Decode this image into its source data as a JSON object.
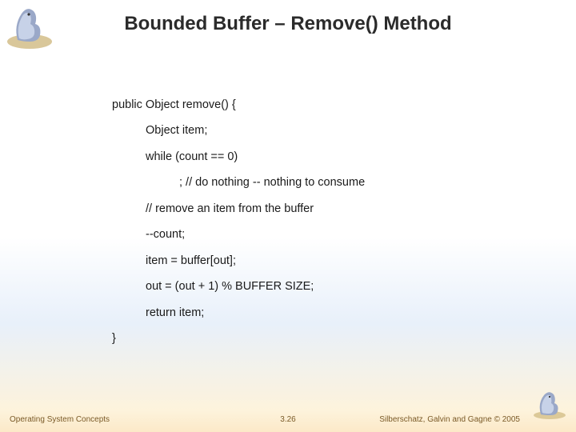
{
  "title": "Bounded Buffer – Remove() Method",
  "code": {
    "line1": "public Object remove() {",
    "line2": "Object item;",
    "line3": "while (count == 0)",
    "line4": "; // do nothing -- nothing to consume",
    "line5": "// remove an item from the buffer",
    "line6": "--count;",
    "line7": "item = buffer[out];",
    "line8": "out = (out + 1) % BUFFER SIZE;",
    "line9": "return item;",
    "line10": "}"
  },
  "footer": {
    "left": "Operating System Concepts",
    "center": "3.26",
    "right": "Silberschatz, Galvin and Gagne © 2005"
  }
}
